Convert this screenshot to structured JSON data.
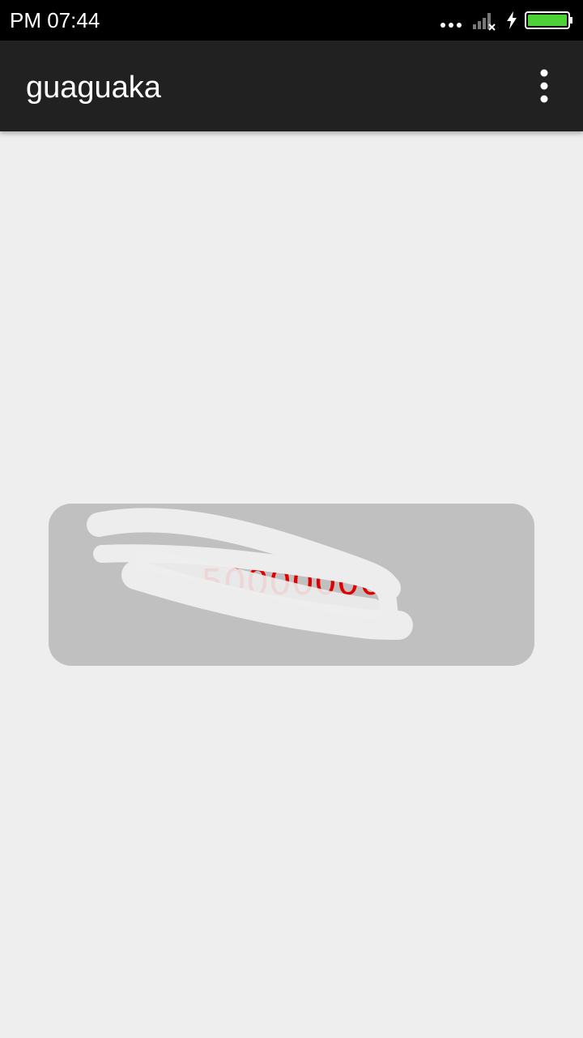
{
  "status_bar": {
    "time": "PM 07:44",
    "icons": [
      "more-dots-icon",
      "signal-no-sim-icon",
      "charging-icon",
      "battery-icon"
    ],
    "battery_color": "#4cd137"
  },
  "app_bar": {
    "title": "guaguaka",
    "overflow_icon": "overflow-menu-icon"
  },
  "scratch_card": {
    "value": "50000000",
    "value_color": "#e00000",
    "card_color": "#c0c0c0"
  }
}
